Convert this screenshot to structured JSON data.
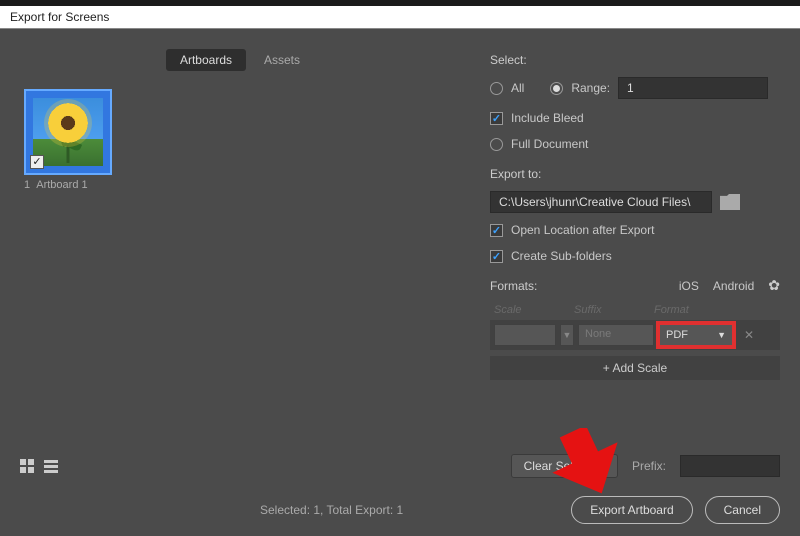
{
  "window": {
    "title": "Export for Screens"
  },
  "tabs": {
    "artboards": "Artboards",
    "assets": "Assets"
  },
  "artboard": {
    "index": "1",
    "name": "Artboard 1"
  },
  "select": {
    "label": "Select:",
    "all": "All",
    "range": "Range:",
    "range_value": "1",
    "include_bleed": "Include Bleed",
    "full_document": "Full Document"
  },
  "export_to": {
    "label": "Export to:",
    "path": "C:\\Users\\jhunr\\Creative Cloud Files\\",
    "open_after": "Open Location after Export",
    "sub_folders": "Create Sub-folders"
  },
  "formats": {
    "label": "Formats:",
    "ios": "iOS",
    "android": "Android",
    "col_scale": "Scale",
    "col_suffix": "Suffix",
    "col_format": "Format",
    "suffix_value": "None",
    "format_value": "PDF",
    "add_scale": "+  Add Scale"
  },
  "footer": {
    "clear": "Clear Selection",
    "prefix": "Prefix:",
    "status": "Selected: 1, Total Export: 1",
    "export": "Export Artboard",
    "cancel": "Cancel"
  }
}
